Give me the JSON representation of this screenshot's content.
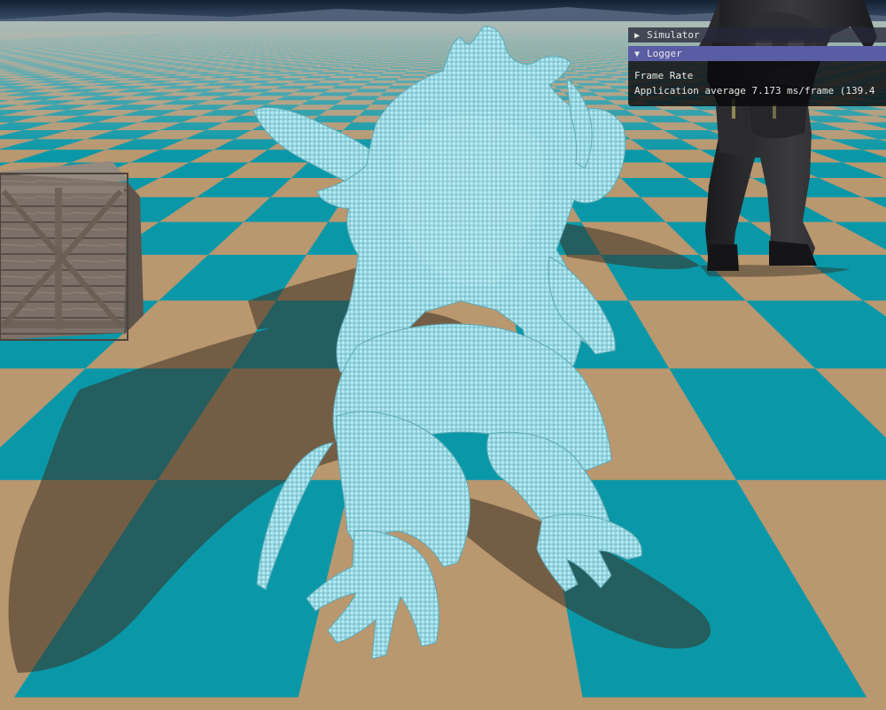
{
  "colors": {
    "sky_top": "#1a2433",
    "mountains": "#55637a",
    "tile_teal": "#0a98a8",
    "tile_tan": "#b9976f",
    "haze": "#9fb2b0",
    "particles": "#8fd0dc",
    "panel_active": "#5a5ca4",
    "panel_body": "#0a0a0c"
  },
  "scene": {
    "objects": [
      "floor-grid",
      "wooden-crate",
      "fluid-particle-creature",
      "armored-character"
    ]
  },
  "panels": {
    "simulator": {
      "label": "Simulator",
      "expanded": false,
      "icon": "triangle-right-icon"
    },
    "logger": {
      "label": "Logger",
      "expanded": true,
      "icon": "triangle-down-icon",
      "lines": [
        "Frame Rate",
        "Application average 7.173 ms/frame (139.4"
      ]
    }
  }
}
